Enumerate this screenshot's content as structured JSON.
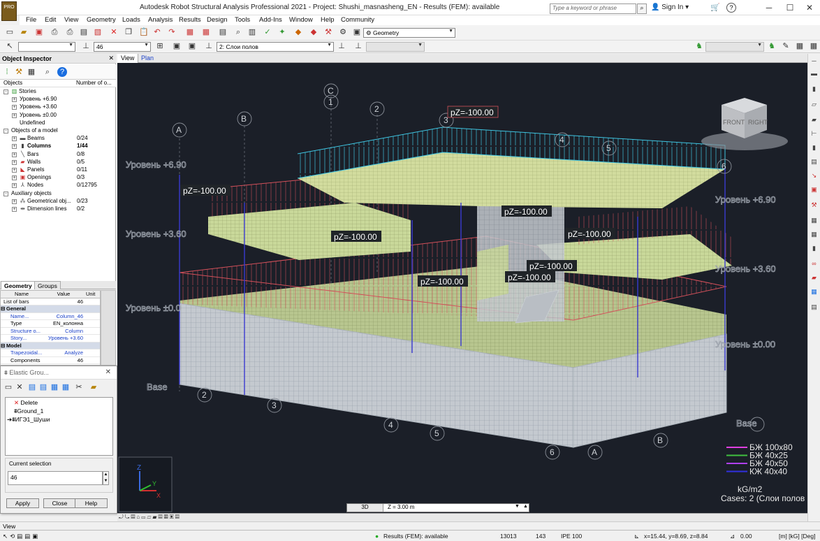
{
  "window": {
    "title": "Autodesk Robot Structural Analysis Professional 2021 - Project: Shushi_masnasheng_EN - Results (FEM): available",
    "search_placeholder": "Type a keyword or phrase",
    "sign_in": "Sign In",
    "logo_text": "PRO"
  },
  "menu": [
    "File",
    "Edit",
    "View",
    "Geometry",
    "Loads",
    "Analysis",
    "Results",
    "Design",
    "Tools",
    "Add-Ins",
    "Window",
    "Help",
    "Community"
  ],
  "toolbar": {
    "layout_combo": "Geometry",
    "bar_number": "46",
    "case_combo": "2: Слои полов"
  },
  "inspector": {
    "title": "Object Inspector",
    "col_objects": "Objects",
    "col_number": "Number of o...",
    "tree": [
      {
        "label": "Stories",
        "value": "",
        "depth": 0,
        "toggle": "-",
        "icon": "stories-icon"
      },
      {
        "label": "Уровень +6.90",
        "value": "",
        "depth": 1,
        "toggle": "+",
        "icon": ""
      },
      {
        "label": "Уровень +3.60",
        "value": "",
        "depth": 1,
        "toggle": "+",
        "icon": ""
      },
      {
        "label": "Уровень ±0.00",
        "value": "",
        "depth": 1,
        "toggle": "+",
        "icon": ""
      },
      {
        "label": "Undefined",
        "value": "",
        "depth": 1,
        "toggle": "",
        "icon": ""
      },
      {
        "label": "Objects of a model",
        "value": "",
        "depth": 0,
        "toggle": "-",
        "icon": ""
      },
      {
        "label": "Beams",
        "value": "0/24",
        "depth": 1,
        "toggle": "+",
        "icon": "beam-icon"
      },
      {
        "label": "Columns",
        "value": "1/44",
        "depth": 1,
        "toggle": "+",
        "icon": "column-icon",
        "bold": true
      },
      {
        "label": "Bars",
        "value": "0/8",
        "depth": 1,
        "toggle": "+",
        "icon": "bar-icon"
      },
      {
        "label": "Walls",
        "value": "0/5",
        "depth": 1,
        "toggle": "+",
        "icon": "wall-icon"
      },
      {
        "label": "Panels",
        "value": "0/11",
        "depth": 1,
        "toggle": "+",
        "icon": "panel-icon"
      },
      {
        "label": "Openings",
        "value": "0/3",
        "depth": 1,
        "toggle": "+",
        "icon": "opening-icon"
      },
      {
        "label": "Nodes",
        "value": "0/12795",
        "depth": 1,
        "toggle": "+",
        "icon": "node-icon"
      },
      {
        "label": "Auxiliary objects",
        "value": "",
        "depth": 0,
        "toggle": "-",
        "icon": ""
      },
      {
        "label": "Geometrical obj...",
        "value": "0/23",
        "depth": 1,
        "toggle": "+",
        "icon": "geometry-object-icon"
      },
      {
        "label": "Dimension lines",
        "value": "0/2",
        "depth": 1,
        "toggle": "+",
        "icon": "dimension-icon"
      }
    ],
    "tabs": [
      "Geometry",
      "Groups"
    ]
  },
  "properties": {
    "headers": {
      "name": "Name",
      "value": "Value",
      "unit": "Unit"
    },
    "list_label": "List of bars",
    "list_value": "46",
    "sections": [
      {
        "title": "General",
        "rows": [
          {
            "name": "Name...",
            "value": "Column_46",
            "blue": true
          },
          {
            "name": "Type",
            "value": "EN_колонна",
            "blue": false
          },
          {
            "name": "Structure o...",
            "value": "Column",
            "blue": true
          },
          {
            "name": "Story...",
            "value": "Уровень +3.60",
            "blue": true
          }
        ]
      },
      {
        "title": "Model",
        "rows": [
          {
            "name": "Trapezoidal...",
            "value": "Analyze",
            "blue": true
          },
          {
            "name": "Components",
            "value": "46",
            "blue": false
          }
        ]
      }
    ]
  },
  "elastic_ground": {
    "title": "Elastic Grou...",
    "items": [
      "Delete",
      "Ground_1",
      "ИГЭ1_Шуши"
    ],
    "current_selection_label": "Current selection",
    "current_selection_value": "46",
    "buttons": [
      "Apply",
      "Close",
      "Help"
    ]
  },
  "viewport": {
    "tabs": [
      "View",
      "Plan"
    ],
    "levels_left": [
      "Уровень +6.90",
      "Уровень +3.60",
      "Уровень ±0.0",
      "Base"
    ],
    "levels_right": [
      "Уровень +6.90",
      "Уровень +3.60",
      "Уровень ±0.00",
      "Base"
    ],
    "grid_letters": [
      "A",
      "B",
      "C",
      "A",
      "B"
    ],
    "grid_numbers": [
      "1",
      "2",
      "3",
      "4",
      "5",
      "6",
      "2",
      "3",
      "4",
      "5",
      "6"
    ],
    "loads": [
      "pZ=-100.00",
      "pZ=-100.00",
      "pZ=-100.00",
      "pZ=-100.00",
      "pZ=-100.00",
      "pZ=-100.00",
      "pZ=-100.00",
      "pZ=-100.00"
    ],
    "view_cube": {
      "front": "FRONT",
      "right": "RIGHT"
    },
    "legend": [
      {
        "label": "БЖ 100x80",
        "color": "#e040e0"
      },
      {
        "label": "БЖ 40x25",
        "color": "#40c040"
      },
      {
        "label": "БЖ 40x50",
        "color": "#b040ff"
      },
      {
        "label": "КЖ 40x40",
        "color": "#3030e0"
      }
    ],
    "units_label": "kG/m2",
    "cases_label": "Cases: 2 (Слои полов",
    "axis": {
      "z": "Z",
      "y": "Y",
      "x": "X"
    },
    "z_strip_tab": "3D",
    "z_value": "Z = 3.00 m"
  },
  "status": {
    "view_label": "View",
    "results": "Results (FEM): available",
    "nodes": "13013",
    "bar": "143",
    "section": "IPE 100",
    "coords": "x=15.44, y=8.69, z=8.84",
    "angle": "0.00",
    "units": "[m] [kG] [Deg]"
  }
}
